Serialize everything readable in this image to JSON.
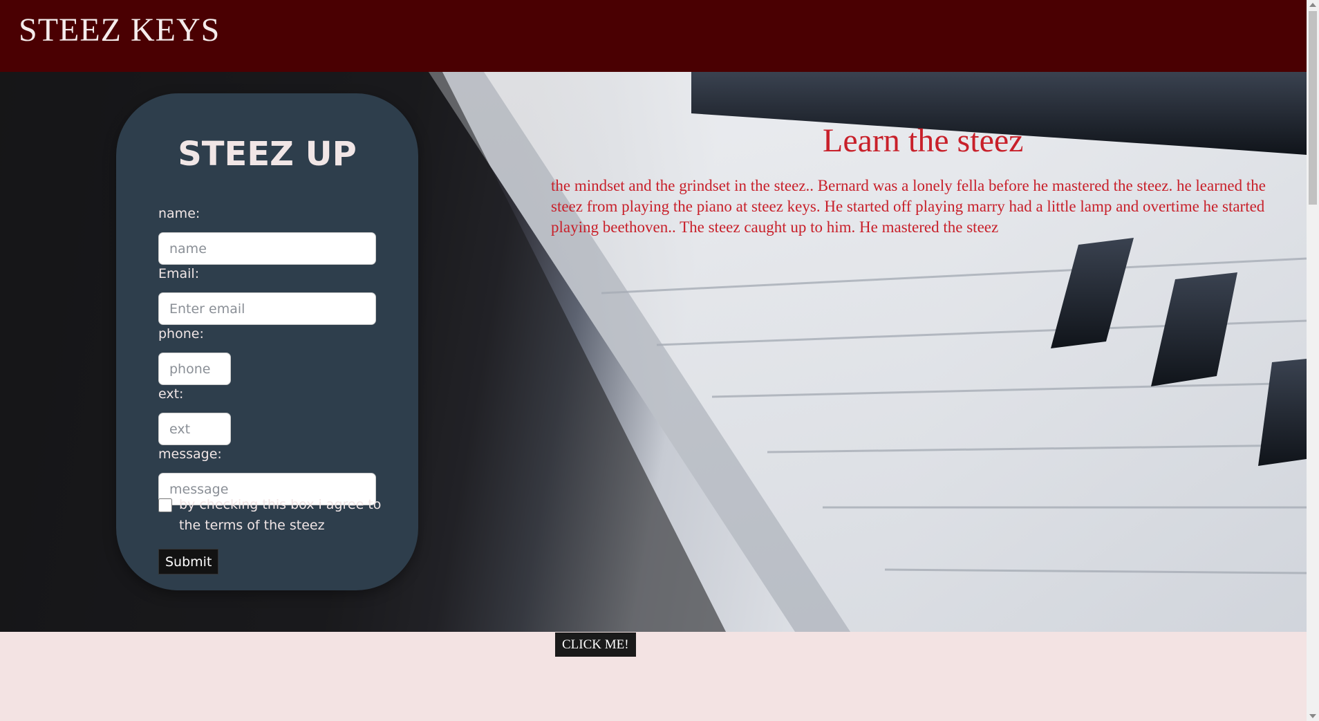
{
  "header": {
    "brand": "STEEZ KEYS"
  },
  "form": {
    "title": "STEEZ UP",
    "name_label": "name:",
    "name_placeholder": "name",
    "email_label": "Email:",
    "email_placeholder": "Enter email",
    "phone_label": "phone:",
    "phone_placeholder": "phone",
    "ext_label": "ext:",
    "ext_placeholder": "ext",
    "message_label": "message:",
    "message_placeholder": "message",
    "checkbox_label": "by checking this box i agree to the terms of the steez",
    "submit_label": "Submit"
  },
  "content": {
    "title": "Learn the steez",
    "text": "the mindset and the grindset in the steez.. Bernard was a lonely fella before he mastered the steez. he learned the steez from playing the piano at steez keys. He started off playing marry had a little lamp and overtime he started playing beethoven.. The steez caught up to him. He mastered the steez"
  },
  "footer": {
    "button_label": "CLICK ME!"
  },
  "colors": {
    "header": "#4a0002",
    "card": "#2e3e4c",
    "accent_text": "#c8202a",
    "page_bg": "#f3e3e3"
  }
}
